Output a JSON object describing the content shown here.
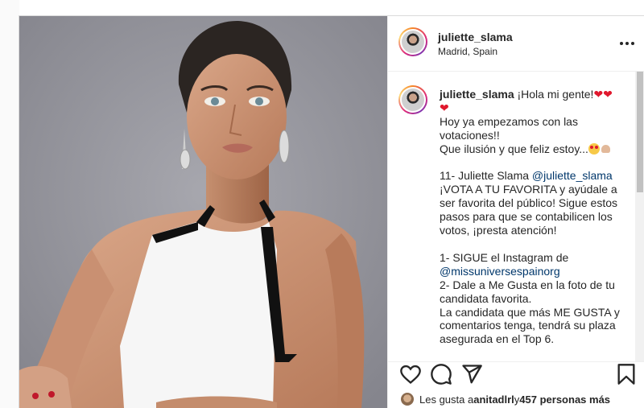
{
  "post": {
    "username": "juliette_slama",
    "location": "Madrid, Spain"
  },
  "caption": {
    "username": "juliette_slama",
    "greeting": " ¡Hola mi gente!",
    "line2": "Hoy ya empezamos con las votaciones!!",
    "line3": "Que ilusión y que feliz estoy...",
    "line4_prefix": "11- Juliette Slama ",
    "line4_mention": "@juliette_slama",
    "line5": "¡VOTA A TU FAVORITA y ayúdale a ser favorita del público! Sigue estos pasos para que se contabilicen los votos, ¡presta atención!",
    "line6_prefix": "1- SIGUE el Instagram de ",
    "line6_mention": "@missuniversespainorg",
    "line7": "2- Dale a Me Gusta en la foto de tu candidata favorita.",
    "line8": "La candidata que más ME GUSTA y comentarios tenga, tendrá su plaza asegurada en el Top 6."
  },
  "likes": {
    "prefix": "Les gusta a ",
    "user": "anitadlrl",
    "middle": " y ",
    "count": "457 personas más"
  },
  "icons": {
    "more": "more-options-icon",
    "like": "heart-icon",
    "comment": "comment-icon",
    "share": "paper-plane-icon",
    "save": "bookmark-icon"
  },
  "colors": {
    "mention": "#00376b",
    "text": "#262626",
    "heart": "#e0182d",
    "border": "#dbdbdb"
  }
}
